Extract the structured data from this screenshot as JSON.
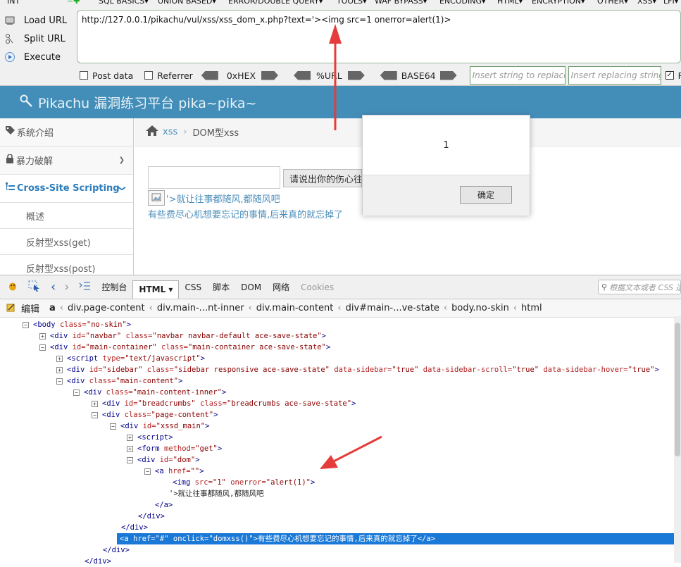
{
  "hackbar": {
    "menu": [
      "INT",
      "SQL BASICS▾",
      "UNION BASED▾",
      "ERROR/DOUBLE QUERY▾",
      "TOOLS▾",
      "WAF BYPASS▾",
      "ENCODING▾",
      "HTML▾",
      "ENCRYPTION▾",
      "OTHER▾",
      "XSS▾",
      "LFI▾"
    ],
    "load_url": "Load URL",
    "split_url": "Split URL",
    "execute": "Execute",
    "url": "http://127.0.0.1/pikachu/vul/xss/xss_dom_x.php?text='><img src=1 onerror=alert(1)>",
    "post_data": "Post data",
    "referrer": "Referrer",
    "hex": "0xHEX",
    "url_enc": "%URL",
    "base64": "BASE64",
    "insert_placeholder": "Insert string to replace",
    "replacing_placeholder": "Insert replacing string",
    "replace_all": "Re"
  },
  "site": {
    "title": "Pikachu 漏洞练习平台 pika~pika~",
    "sidebar": [
      {
        "label": "系统介绍"
      },
      {
        "label": "暴力破解"
      },
      {
        "label": "Cross-Site Scripting"
      },
      {
        "label": "概述"
      },
      {
        "label": "反射型xss(get)"
      },
      {
        "label": "反射型xss(post)"
      }
    ],
    "breadcrumb": {
      "link": "xss",
      "current": "DOM型xss"
    },
    "button_label": "请说出你的伤心往",
    "dom_text": "'>就让往事都随风,都随风吧",
    "link_text": "有些费尽心机想要忘记的事情,后来真的就忘掉了"
  },
  "dialog": {
    "message": "1",
    "ok_label": "确定"
  },
  "devtools": {
    "tabs": [
      "控制台",
      "HTML ▾",
      "CSS",
      "脚本",
      "DOM",
      "网络",
      "Cookies"
    ],
    "search_placeholder": "根据文本或者 CSS 选",
    "edit_label": "编辑",
    "crumbs": [
      "a",
      "div.page-content",
      "div.main-...nt-inner",
      "div.main-content",
      "div#main-...ve-state",
      "body.no-skin",
      "html"
    ],
    "tree": [
      {
        "tog": "−",
        "parts": [
          [
            "tg",
            "<body  "
          ],
          [
            "an",
            "class="
          ],
          [
            "av",
            "\"no-skin\""
          ],
          [
            "tg",
            ">"
          ]
        ]
      },
      {
        "tog": "+",
        "parts": [
          [
            "tg",
            "<div  "
          ],
          [
            "an",
            "id="
          ],
          [
            "av",
            "\"navbar\"  "
          ],
          [
            "an",
            "class="
          ],
          [
            "av",
            "\"navbar navbar-default ace-save-state\""
          ],
          [
            "tg",
            ">"
          ]
        ]
      },
      {
        "tog": "−",
        "parts": [
          [
            "tg",
            "<div  "
          ],
          [
            "an",
            "id="
          ],
          [
            "av",
            "\"main-container\"  "
          ],
          [
            "an",
            "class="
          ],
          [
            "av",
            "\"main-container ace-save-state\""
          ],
          [
            "tg",
            ">"
          ]
        ]
      },
      {
        "tog": "+",
        "parts": [
          [
            "tg",
            "<script  "
          ],
          [
            "an",
            "type="
          ],
          [
            "av",
            "\"text/javascript\""
          ],
          [
            "tg",
            ">"
          ]
        ]
      },
      {
        "tog": "+",
        "parts": [
          [
            "tg",
            "<div  "
          ],
          [
            "an",
            "id="
          ],
          [
            "av",
            "\"sidebar\"  "
          ],
          [
            "an",
            "class="
          ],
          [
            "av",
            "\"sidebar responsive ace-save-state\"  "
          ],
          [
            "an",
            "data-sidebar="
          ],
          [
            "av",
            "\"true\"  "
          ],
          [
            "an",
            "data-sidebar-scroll="
          ],
          [
            "av",
            "\"true\"  "
          ],
          [
            "an",
            "data-sidebar-hover="
          ],
          [
            "av",
            "\"true\""
          ],
          [
            "tg",
            ">"
          ]
        ]
      },
      {
        "tog": "−",
        "parts": [
          [
            "tg",
            "<div  "
          ],
          [
            "an",
            "class="
          ],
          [
            "av",
            "\"main-content\""
          ],
          [
            "tg",
            ">"
          ]
        ]
      },
      {
        "tog": "−",
        "parts": [
          [
            "tg",
            "<div  "
          ],
          [
            "an",
            "class="
          ],
          [
            "av",
            "\"main-content-inner\""
          ],
          [
            "tg",
            ">"
          ]
        ]
      },
      {
        "tog": "+",
        "parts": [
          [
            "tg",
            "<div  "
          ],
          [
            "an",
            "id="
          ],
          [
            "av",
            "\"breadcrumbs\"  "
          ],
          [
            "an",
            "class="
          ],
          [
            "av",
            "\"breadcrumbs ace-save-state\""
          ],
          [
            "tg",
            ">"
          ]
        ]
      },
      {
        "tog": "−",
        "parts": [
          [
            "tg",
            "<div  "
          ],
          [
            "an",
            "class="
          ],
          [
            "av",
            "\"page-content\""
          ],
          [
            "tg",
            ">"
          ]
        ]
      },
      {
        "tog": "−",
        "parts": [
          [
            "tg",
            "<div  "
          ],
          [
            "an",
            "id="
          ],
          [
            "av",
            "\"xssd_main\""
          ],
          [
            "tg",
            ">"
          ]
        ]
      },
      {
        "tog": "+",
        "parts": [
          [
            "tg",
            "<script>"
          ]
        ]
      },
      {
        "tog": "+",
        "parts": [
          [
            "tg",
            "<form  "
          ],
          [
            "an",
            "method="
          ],
          [
            "av",
            "\"get\""
          ],
          [
            "tg",
            ">"
          ]
        ]
      },
      {
        "tog": "−",
        "parts": [
          [
            "tg",
            "<div  "
          ],
          [
            "an",
            "id="
          ],
          [
            "av",
            "\"dom\""
          ],
          [
            "tg",
            ">"
          ]
        ]
      },
      {
        "tog": "−",
        "parts": [
          [
            "tg",
            "<a  "
          ],
          [
            "an",
            "href="
          ],
          [
            "av",
            "\"\""
          ],
          [
            "tg",
            ">"
          ]
        ]
      },
      {
        "tog": "",
        "parts": [
          [
            "tg",
            "<img  "
          ],
          [
            "an",
            "src="
          ],
          [
            "av",
            "\"1\"  "
          ],
          [
            "an",
            "onerror="
          ],
          [
            "av",
            "\"alert(1)\""
          ],
          [
            "tg",
            ">"
          ]
        ]
      },
      {
        "tog": "",
        "parts": [
          [
            "tx",
            "'>就让往事都随风,都随风吧"
          ]
        ]
      },
      {
        "tog": "",
        "parts": [
          [
            "tg",
            "</a>"
          ]
        ]
      },
      {
        "tog": "",
        "parts": [
          [
            "tg",
            "</div>"
          ]
        ]
      },
      {
        "tog": "",
        "parts": [
          [
            "tg",
            "</div>"
          ]
        ]
      },
      {
        "tog": "",
        "parts": [
          [
            "tg",
            "<a  "
          ],
          [
            "an",
            "href="
          ],
          [
            "av",
            "\"#\"  "
          ],
          [
            "an",
            "onclick="
          ],
          [
            "av",
            "\"domxss()\""
          ],
          [
            "tg",
            ">"
          ],
          [
            "tx",
            "有些费尽心机想要忘记的事情,后来真的就忘掉了"
          ],
          [
            "tg",
            "</a>"
          ]
        ]
      },
      {
        "tog": "",
        "parts": [
          [
            "tg",
            "</div>"
          ]
        ]
      },
      {
        "tog": "",
        "parts": [
          [
            "tg",
            "</div>"
          ]
        ]
      }
    ]
  },
  "colors": {
    "accent": "#438eb9",
    "selection": "#1a78d6",
    "arrow": "#e63b3b"
  }
}
